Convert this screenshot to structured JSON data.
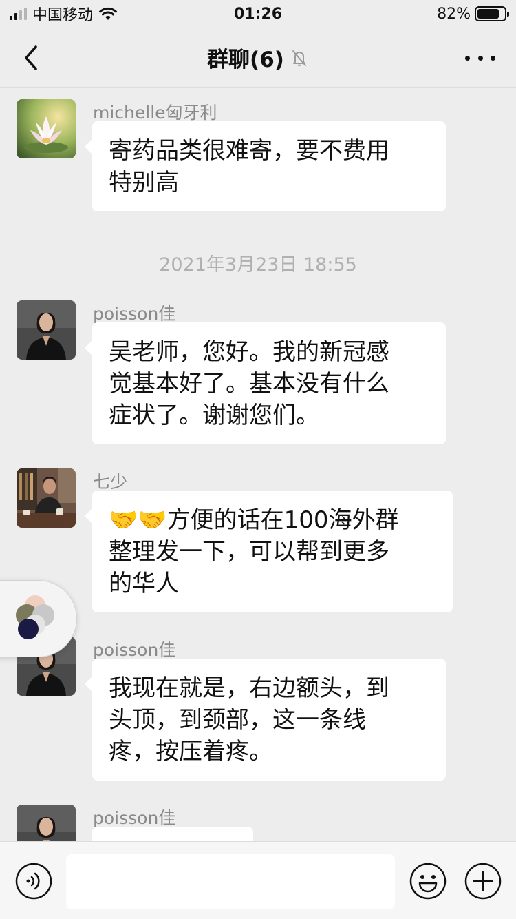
{
  "status_bar": {
    "carrier": "中国移动",
    "time": "01:26",
    "battery": "82%",
    "battery_level": 0.82
  },
  "nav": {
    "title": "群聊(6)",
    "back_icon": "chevron-left-icon",
    "mute_icon": "bell-off-icon",
    "more_icon": "more-dots-icon"
  },
  "messages": [
    {
      "sender": "michelle匈牙利",
      "lines": [
        "寄药品类很难寄，要不费用",
        "特别高"
      ]
    },
    {
      "sender": "poisson佳",
      "lines": [
        "吴老师，您好。我的新冠感",
        "觉基本好了。基本没有什么",
        "症状了。谢谢您们。"
      ]
    },
    {
      "sender": "七少",
      "lines": [
        "🤝🤝方便的话在100海外群",
        "整理发一下，可以帮到更多",
        "的华人"
      ]
    },
    {
      "sender": "poisson佳",
      "lines": [
        "我现在就是，右边额头，到",
        "头顶，到颈部，这一条线",
        "疼，按压着疼。"
      ]
    },
    {
      "sender": "poisson佳",
      "lines": [
        ""
      ]
    }
  ],
  "timestamp": "2021年3月23日 18:55",
  "input_bar": {
    "voice_icon": "voice-icon",
    "input_value": "",
    "emoji_icon": "emoji-icon",
    "plus_icon": "plus-icon"
  }
}
